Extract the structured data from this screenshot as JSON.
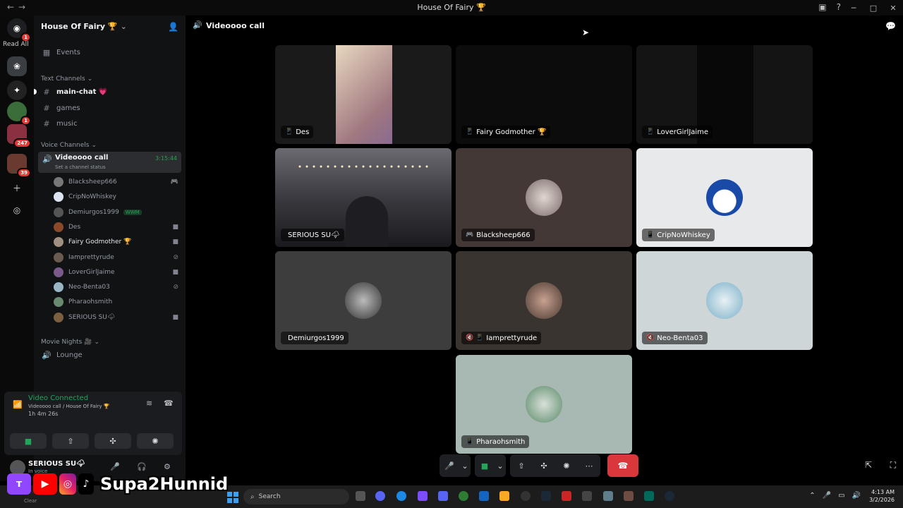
{
  "window": {
    "title": "House Of Fairy 🏆"
  },
  "servers": {
    "read_all": "Read All",
    "badges": [
      "1",
      "1",
      "247",
      "39"
    ]
  },
  "sidebar": {
    "server_name": "House Of Fairy 🏆",
    "events": "Events",
    "text_category": "Text Channels",
    "text_channels": [
      "main-chat 💗",
      "games",
      "music"
    ],
    "voice_category": "Voice Channels",
    "active_voice": {
      "name": "Videoooo call",
      "timer": "3:15:44",
      "status": "Set a channel status"
    },
    "members": [
      {
        "name": "Blacksheep666",
        "bright": false
      },
      {
        "name": "CripNoWhiskey",
        "bright": false
      },
      {
        "name": "Demiurgos1999",
        "bright": false,
        "tag": "WWM"
      },
      {
        "name": "Des",
        "bright": false
      },
      {
        "name": "Fairy Godmother 🏆",
        "bright": true
      },
      {
        "name": "Iamprettyrude",
        "bright": false
      },
      {
        "name": "LoverGirlJaime",
        "bright": false
      },
      {
        "name": "Neo-Benta03",
        "bright": false
      },
      {
        "name": "Pharaohsmith",
        "bright": false
      },
      {
        "name": "SERIOUS SU🌩",
        "bright": false
      }
    ],
    "movie_category": "Movie Nights 🎥",
    "lounge": "Lounge"
  },
  "voice_panel": {
    "status": "Video Connected",
    "channel": "Videoooo call / House Of Fairy 🏆",
    "duration": "1h 4m 26s"
  },
  "user_panel": {
    "name": "SERIOUS SU🌩",
    "sub": "In voice"
  },
  "main": {
    "title": "Videoooo call"
  },
  "tiles": [
    {
      "name": "Des",
      "icon": "📱"
    },
    {
      "name": "Fairy Godmother 🏆",
      "icon": "📱"
    },
    {
      "name": "LoverGirlJaime",
      "icon": "📱"
    },
    {
      "name": "SERIOUS SU🌩",
      "icon": ""
    },
    {
      "name": "Blacksheep666",
      "icon": "🎮"
    },
    {
      "name": "CripNoWhiskey",
      "icon": "📱"
    },
    {
      "name": "Demiurgos1999",
      "icon": ""
    },
    {
      "name": "Iamprettyrude",
      "icon": "🔇 📱"
    },
    {
      "name": "Neo-Benta03",
      "icon": "🔇"
    },
    {
      "name": "Pharaohsmith",
      "icon": "📱"
    }
  ],
  "taskbar": {
    "search_placeholder": "Search",
    "time": "4:13 AM",
    "date": "3/2/2026"
  },
  "watermark": {
    "name": "Supa2Hunnid",
    "clear": "Clear"
  },
  "colors": {
    "accent_green": "#23a559",
    "hangup_red": "#da373c",
    "badge_red": "#e53935"
  }
}
